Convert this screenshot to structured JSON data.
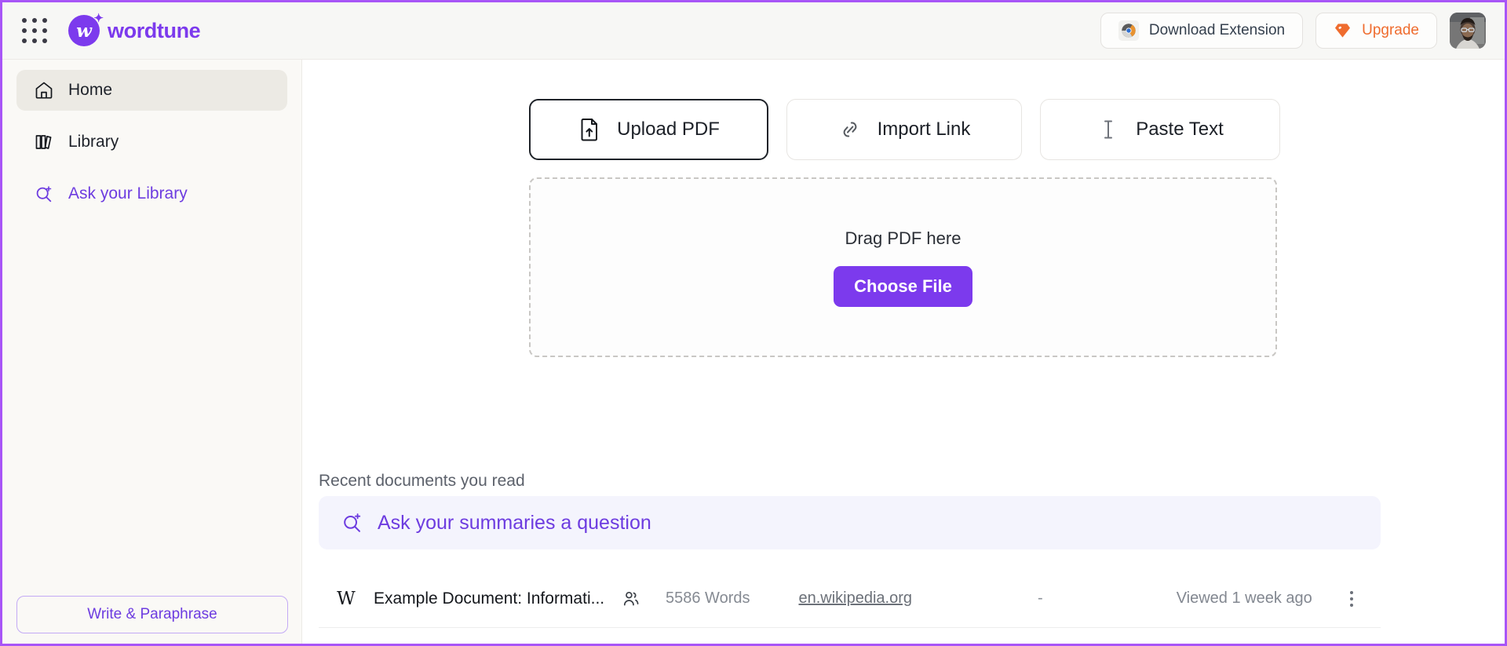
{
  "topbar": {
    "grid_icon": "apps-grid-icon",
    "brand_letter": "w",
    "brand_name": "wordtune",
    "download_extension_label": "Download Extension",
    "download_extension_icon": "chrome-icon",
    "upgrade_label": "Upgrade",
    "upgrade_icon": "gem-icon",
    "avatar_alt": "user-avatar"
  },
  "sidebar": {
    "items": [
      {
        "label": "Home",
        "icon": "home-icon",
        "active": true
      },
      {
        "label": "Library",
        "icon": "books-icon",
        "active": false
      },
      {
        "label": "Ask your Library",
        "icon": "search-sparkle-icon",
        "active": false
      }
    ],
    "write_paraphrase_label": "Write & Paraphrase"
  },
  "main": {
    "source_buttons": [
      {
        "label": "Upload PDF",
        "icon": "file-upload-icon",
        "selected": true
      },
      {
        "label": "Import Link",
        "icon": "link-icon",
        "selected": false
      },
      {
        "label": "Paste Text",
        "icon": "text-cursor-icon",
        "selected": false
      }
    ],
    "dropzone": {
      "drag_text": "Drag PDF here",
      "choose_file_label": "Choose File"
    },
    "recent_section_title": "Recent documents you read",
    "ask_summaries": {
      "placeholder": "Ask your summaries a question",
      "icon": "search-sparkle-icon"
    },
    "documents": [
      {
        "favicon_letter": "W",
        "title": "Example Document: Informati...",
        "shared_icon": "people-icon",
        "words": "5586 Words",
        "source": "en.wikipedia.org",
        "extra": "-",
        "viewed": "Viewed 1 week ago",
        "menu_icon": "kebab-menu-icon"
      }
    ]
  },
  "colors": {
    "brand_purple": "#7c3aed",
    "accent_purple": "#6d3ce0",
    "upgrade_orange": "#ef6c2e",
    "frame_border": "#a855f7",
    "sidebar_bg": "#faf9f6",
    "topbar_bg": "#f7f7f5"
  }
}
